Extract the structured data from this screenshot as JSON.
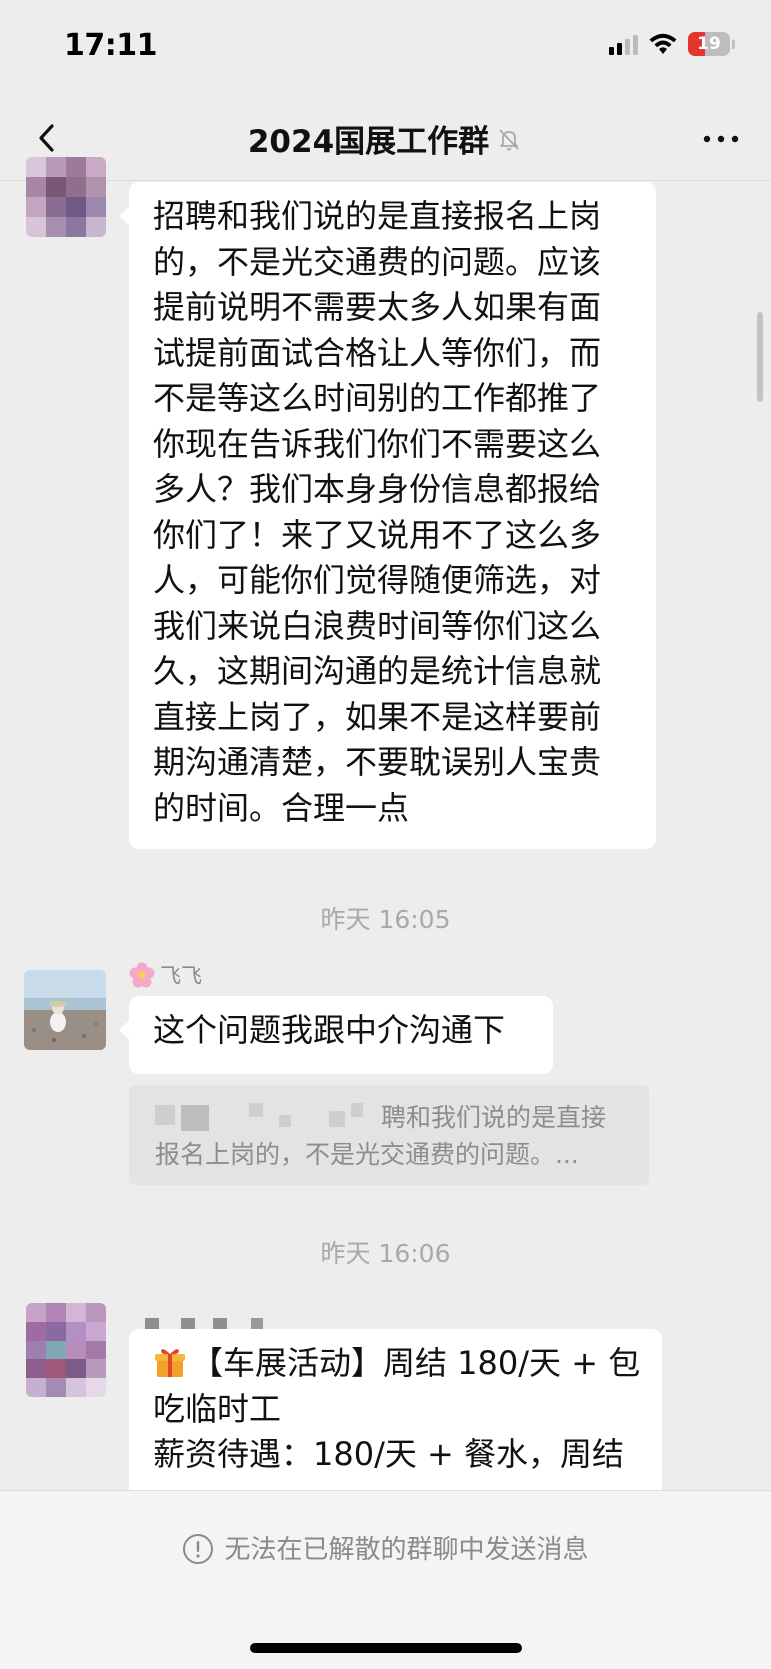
{
  "status_bar": {
    "time": "17:11",
    "battery_level": "19"
  },
  "header": {
    "title": "2024国展工作群",
    "back_icon": "chevron-left-icon",
    "mute_icon": "bell-off-icon",
    "more_icon": "more-horizontal-icon"
  },
  "messages": [
    {
      "type": "text",
      "lines": [
        "招聘和我们说的是直接报名上岗",
        "的，不是光交通费的问题。应该",
        "提前说明不需要太多人如果有面",
        "试提前面试合格让人等你们，而",
        "不是等这么时间别的工作都推了",
        "你现在告诉我们你们不需要这么",
        "多人？我们本身身份信息都报给",
        "你们了！来了又说用不了这么多",
        "人，可能你们觉得随便筛选，对",
        "我们来说白浪费时间等你们这么",
        "久，这期间沟通的是统计信息就",
        "直接上岗了，如果不是这样要前",
        "期沟通清楚，不要耽误别人宝贵",
        "的时间。合理一点"
      ]
    },
    {
      "type": "timestamp",
      "text": "昨天 16:05"
    },
    {
      "type": "text",
      "sender": "飞飞",
      "text": "这个问题我跟中介沟通下",
      "quote": {
        "line1": "聘和我们说的是直接",
        "line2": "报名上岗的，不是光交通费的问题。..."
      }
    },
    {
      "type": "timestamp",
      "text": "昨天 16:06"
    },
    {
      "type": "text",
      "line1": "【车展活动】周结 180/天 + 包",
      "line2": "吃临时工",
      "line3": "薪资待遇：180/天 + 餐水，周结"
    }
  ],
  "footer": {
    "notice": "无法在已解散的群聊中发送消息"
  },
  "colors": {
    "background": "#ededed",
    "bubble": "#ffffff",
    "timestamp": "#a9a9a9",
    "battery_low": "#e3352b"
  }
}
